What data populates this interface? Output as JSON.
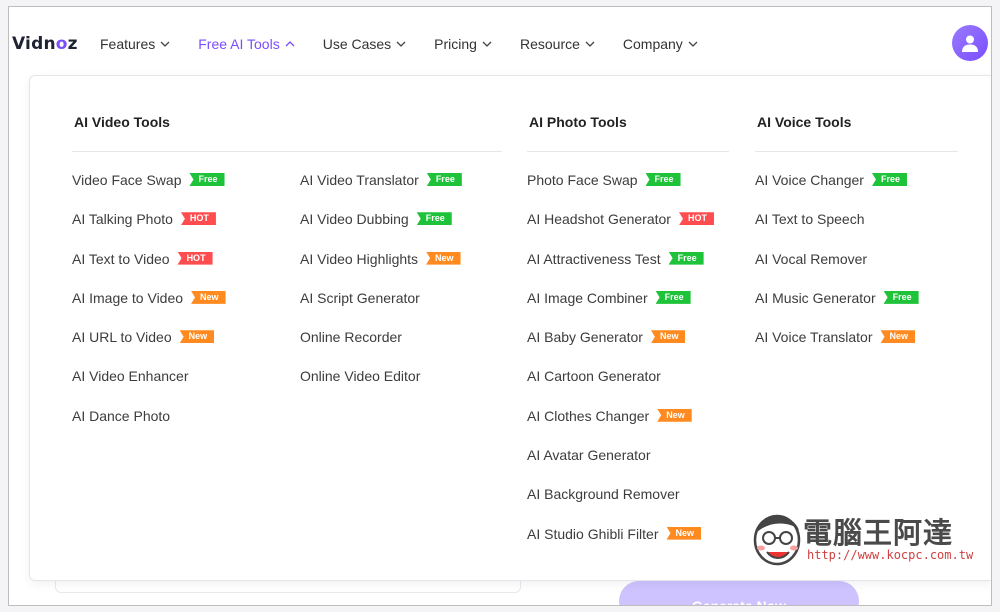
{
  "brand": {
    "name_prefix": "Vidn",
    "name_o": "o",
    "name_suffix": "z"
  },
  "nav": {
    "items": [
      {
        "label": "Features",
        "active": false
      },
      {
        "label": "Free AI Tools",
        "active": true
      },
      {
        "label": "Use Cases",
        "active": false
      },
      {
        "label": "Pricing",
        "active": false
      },
      {
        "label": "Resource",
        "active": false
      },
      {
        "label": "Company",
        "active": false
      }
    ]
  },
  "dropdown": {
    "video": {
      "title": "AI Video Tools",
      "col1": [
        {
          "label": "Video Face Swap",
          "badge": "Free"
        },
        {
          "label": "AI Talking Photo",
          "badge": "HOT"
        },
        {
          "label": "AI Text to Video",
          "badge": "HOT"
        },
        {
          "label": "AI Image to Video",
          "badge": "New"
        },
        {
          "label": "AI URL to Video",
          "badge": "New"
        },
        {
          "label": "AI Video Enhancer",
          "badge": ""
        },
        {
          "label": "AI Dance Photo",
          "badge": ""
        }
      ],
      "col2": [
        {
          "label": "AI Video Translator",
          "badge": "Free"
        },
        {
          "label": "AI Video Dubbing",
          "badge": "Free"
        },
        {
          "label": "AI Video Highlights",
          "badge": "New"
        },
        {
          "label": "AI Script Generator",
          "badge": ""
        },
        {
          "label": "Online Recorder",
          "badge": ""
        },
        {
          "label": "Online Video Editor",
          "badge": ""
        }
      ]
    },
    "photo": {
      "title": "AI Photo Tools",
      "items": [
        {
          "label": "Photo Face Swap",
          "badge": "Free"
        },
        {
          "label": "AI Headshot Generator",
          "badge": "HOT"
        },
        {
          "label": "AI Attractiveness Test",
          "badge": "Free"
        },
        {
          "label": "AI Image Combiner",
          "badge": "Free"
        },
        {
          "label": "AI Baby Generator",
          "badge": "New"
        },
        {
          "label": "AI Cartoon Generator",
          "badge": ""
        },
        {
          "label": "AI Clothes Changer",
          "badge": "New"
        },
        {
          "label": "AI Avatar Generator",
          "badge": ""
        },
        {
          "label": "AI Background Remover",
          "badge": ""
        },
        {
          "label": "AI Studio Ghibli Filter",
          "badge": "New"
        }
      ]
    },
    "voice": {
      "title": "AI Voice Tools",
      "items": [
        {
          "label": "AI Voice Changer",
          "badge": "Free"
        },
        {
          "label": "AI Text to Speech",
          "badge": ""
        },
        {
          "label": "AI Vocal Remover",
          "badge": ""
        },
        {
          "label": "AI Music Generator",
          "badge": "Free"
        },
        {
          "label": "AI Voice Translator",
          "badge": "New"
        }
      ]
    }
  },
  "background": {
    "generate_button": "Generate Now"
  },
  "watermark": {
    "title": "電腦王阿達",
    "url": "http://www.kocpc.com.tw"
  },
  "colors": {
    "accent": "#7a4dff",
    "free": "#1ec33a",
    "hot": "#ff4d4f",
    "new": "#ff8a1f"
  }
}
